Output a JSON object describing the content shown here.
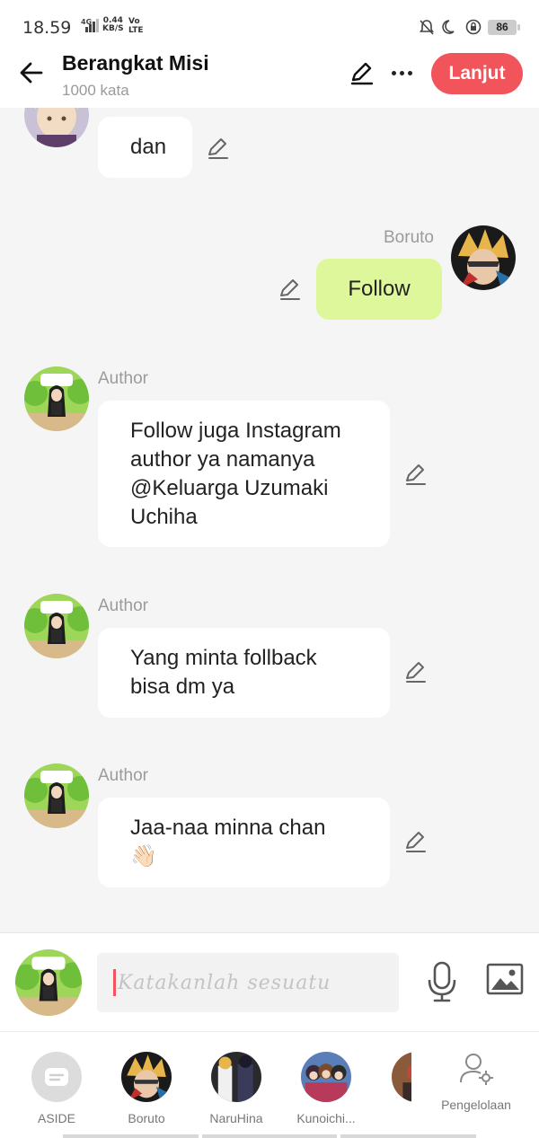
{
  "status_bar": {
    "time": "18.59",
    "network_tag": "4G",
    "speed_value": "0.44",
    "speed_unit": "KB/S",
    "volte_top": "Vo",
    "volte_bottom": "LTE",
    "battery": "86"
  },
  "header": {
    "title": "Berangkat Misi",
    "word_count": "1000 kata",
    "next_label": "Lanjut"
  },
  "messages": [
    {
      "speaker": "",
      "text": "dan",
      "side": "left"
    },
    {
      "speaker": "Boruto",
      "text": "Follow",
      "side": "right"
    },
    {
      "speaker": "Author",
      "text": "Follow juga Instagram author ya namanya @Keluarga Uzumaki Uchiha",
      "side": "left"
    },
    {
      "speaker": "Author",
      "text": "Yang minta follback bisa dm ya",
      "side": "left"
    },
    {
      "speaker": "Author",
      "text": "Jaa-naa minna chan",
      "emoji": "👋🏻",
      "side": "left"
    }
  ],
  "input": {
    "placeholder": "Katakanlah sesuatu"
  },
  "characters": [
    {
      "label": "ASIDE"
    },
    {
      "label": "Boruto"
    },
    {
      "label": "NaruHina"
    },
    {
      "label": "Kunoichi..."
    }
  ],
  "manage_label": "Pengelolaan",
  "colors": {
    "accent": "#f2545b",
    "right_bubble": "#dff79b",
    "chat_bg": "#f5f5f5"
  }
}
